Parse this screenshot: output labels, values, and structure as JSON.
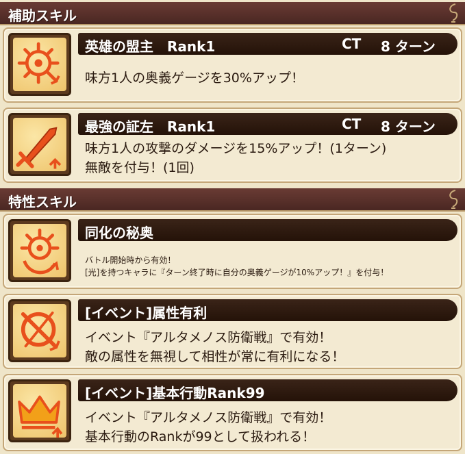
{
  "sections": {
    "support": {
      "title": "補助スキル"
    },
    "trait": {
      "title": "特性スキル"
    }
  },
  "skills": [
    {
      "name": "英雄の盟主　Rank1",
      "ct_label": "CT",
      "ct_value": "8 ターン",
      "desc": [
        "味方1人の奥義ゲージを30%アップ！"
      ],
      "icon": "sun-arrow-icon"
    },
    {
      "name": "最強の証左　Rank1",
      "ct_label": "CT",
      "ct_value": "8 ターン",
      "desc": [
        "味方1人の攻撃のダメージを15%アップ！(1ターン)",
        "無敵を付与！(1回)"
      ],
      "icon": "sword-arrow-icon"
    },
    {
      "name": "同化の秘奥",
      "desc": [
        "バトル開始時から有効！",
        "[光]を持つキャラに『ターン終了時に自分の奥義ゲージが10%アップ！』を付与！"
      ],
      "icon": "sun-cycle-arrow-icon"
    },
    {
      "name": "[イベント]属性有利",
      "desc": [
        "イベント『アルタメノス防衛戦』で有効！",
        "敵の属性を無視して相性が常に有利になる！"
      ],
      "icon": "circle-arrow-icon"
    },
    {
      "name": "[イベント]基本行動Rank99",
      "desc": [
        "イベント『アルタメノス防衛戦』で有効！",
        "基本行動のRankが99として扱われる！"
      ],
      "icon": "crown-arrow-icon"
    }
  ],
  "colors": {
    "header": "#5a302a",
    "title_bar": "#2e1a10",
    "card_bg": "#f3ead2",
    "icon_orange": "#e8501c"
  }
}
